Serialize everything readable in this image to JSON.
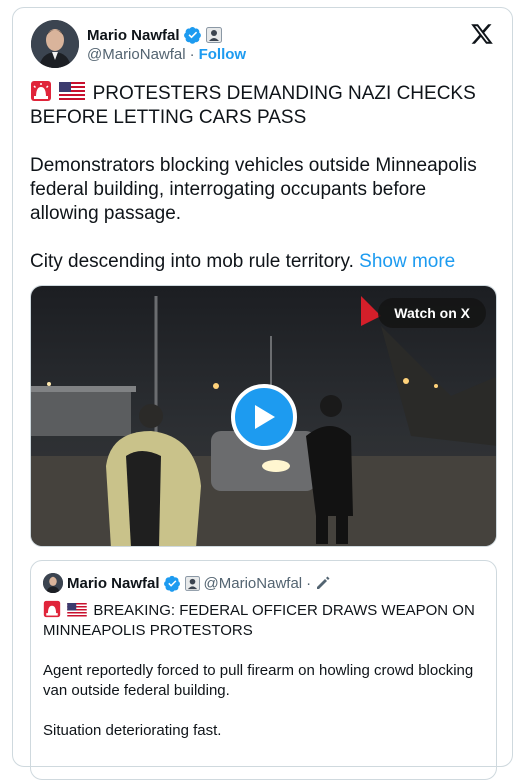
{
  "author": {
    "name": "Mario Nawfal",
    "handle": "@MarioNawfal",
    "separator": "·",
    "follow_label": "Follow"
  },
  "tweet": {
    "headline": "PROTESTERS DEMANDING NAZI CHECKS BEFORE LETTING CARS PASS",
    "paragraph1": "Demonstrators blocking vehicles outside Minneapolis federal building, interrogating occupants before allowing passage.",
    "paragraph2": "City descending into mob rule territory.",
    "show_more": "Show more"
  },
  "media": {
    "watch_label": "Watch on X"
  },
  "quote": {
    "name": "Mario Nawfal",
    "handle": "@MarioNawfal",
    "separator": "·",
    "headline": "BREAKING: FEDERAL OFFICER DRAWS WEAPON ON MINNEAPOLIS PROTESTORS",
    "paragraph1": "Agent reportedly forced to pull firearm on howling crowd blocking van outside federal building.",
    "paragraph2": "Situation deteriorating fast."
  },
  "colors": {
    "accent": "#1d9bf0",
    "text": "#0f1419",
    "muted": "#536471",
    "border": "#cfd9de"
  }
}
